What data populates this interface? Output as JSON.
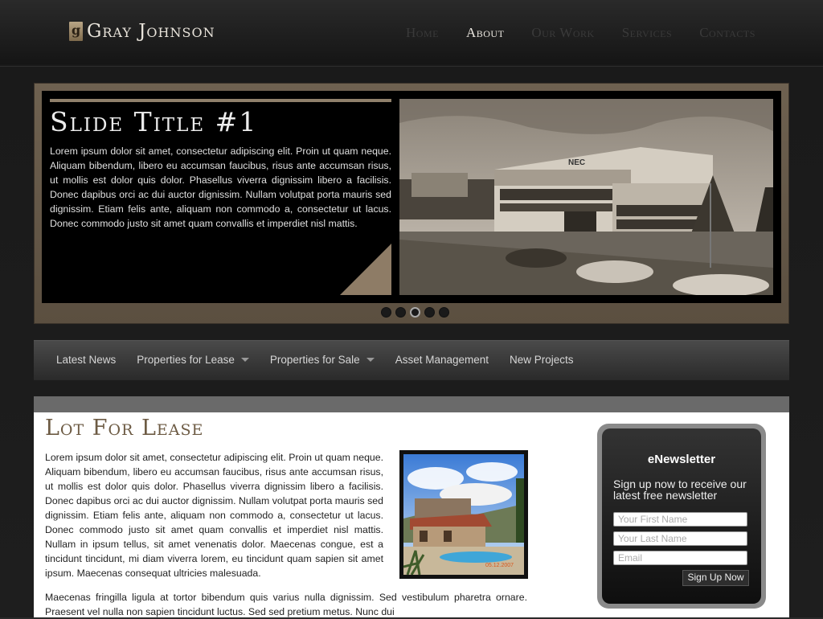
{
  "brand": {
    "name": "Gray Johnson"
  },
  "topnav": [
    "Home",
    "About",
    "Our Work",
    "Services",
    "Contacts"
  ],
  "topnav_active": "About",
  "slider": {
    "title": "Slide Title #1",
    "body": "Lorem ipsum dolor sit amet, consectetur adipiscing elit. Proin ut quam neque. Aliquam bibendum, libero eu accumsan faucibus, risus ante accumsan risus, ut mollis est dolor quis dolor. Phasellus viverra dignissim libero a facilisis. Donec dapibus orci ac dui auctor dignissim. Nullam volutpat porta mauris sed dignissim. Etiam felis ante, aliquam non commodo a, consectetur ut lacus. Donec commodo justo sit amet quam convallis et imperdiet nisl mattis.",
    "photo_sign": "NEC",
    "dots": 5,
    "active_dot": 3
  },
  "catnav": [
    {
      "label": "Latest News",
      "dropdown": false
    },
    {
      "label": "Properties for Lease",
      "dropdown": true
    },
    {
      "label": "Properties for Sale",
      "dropdown": true
    },
    {
      "label": "Asset Management",
      "dropdown": false
    },
    {
      "label": "New Projects",
      "dropdown": false
    }
  ],
  "content": {
    "title": "Lot For Lease",
    "p1": "Lorem ipsum dolor sit amet, consectetur adipiscing elit. Proin ut quam neque. Aliquam bibendum, libero eu accumsan faucibus, risus ante accumsan risus, ut mollis est dolor quis dolor. Phasellus viverra dignissim libero a facilisis. Donec dapibus orci ac dui auctor dignissim. Nullam volutpat porta mauris sed dignissim. Etiam felis ante, aliquam non commodo a, consectetur ut lacus. Donec commodo justo sit amet quam convallis et imperdiet nisl mattis. Nullam in ipsum tellus, sit amet venenatis dolor. Maecenas congue, est a tincidunt tincidunt, mi diam viverra lorem, eu tincidunt quam sapien sit amet ipsum. Maecenas consequat ultricies malesuada.",
    "p2": "Maecenas fringilla ligula at tortor bibendum quis varius nulla dignissim. Sed vestibulum pharetra ornare. Praesent vel nulla non sapien tincidunt luctus. Sed sed pretium metus. Nunc dui",
    "photo_date": "05.12.2007"
  },
  "newsletter": {
    "title": "eNewsletter",
    "desc": "Sign up now to receive our latest free newsletter",
    "first_name_ph": "Your First Name",
    "last_name_ph": "Your Last Name",
    "email_ph": "Email",
    "submit": "Sign Up Now"
  },
  "colors": {
    "accent": "#6d5b44",
    "frame": "#6e6150",
    "background": "#1c1c1c"
  }
}
